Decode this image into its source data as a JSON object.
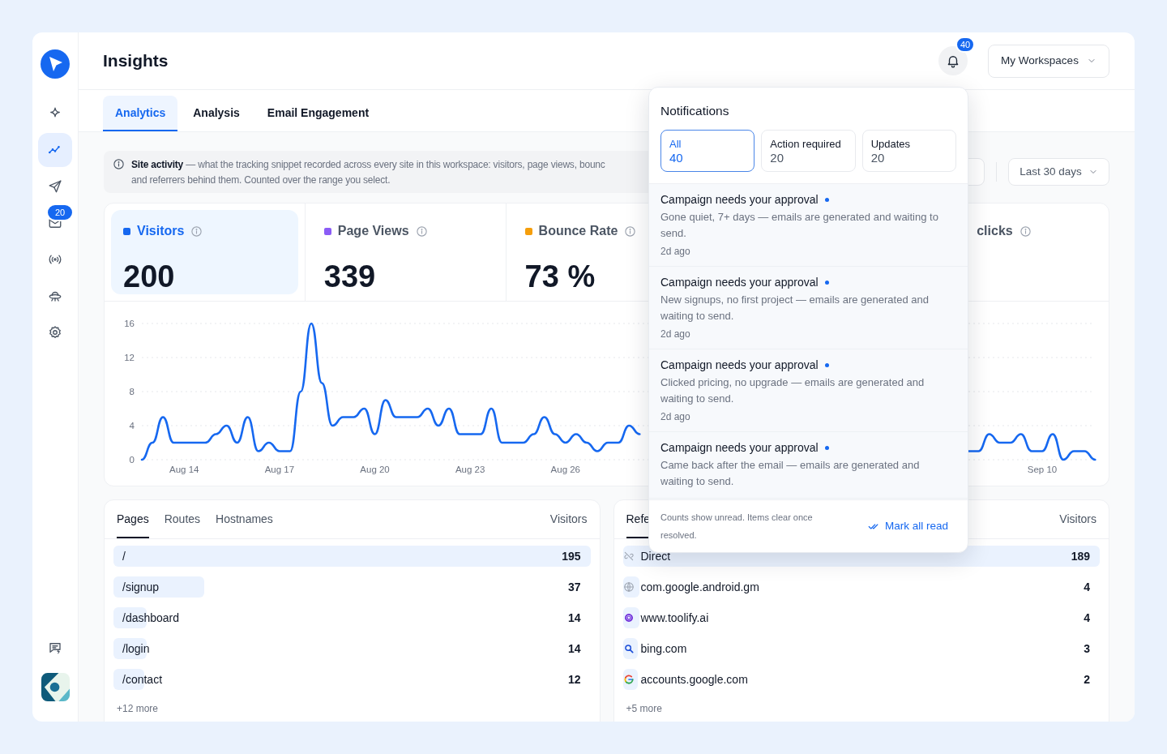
{
  "sidebar": {
    "items": [
      {
        "selected": false
      },
      {
        "selected": true
      },
      {
        "selected": false
      },
      {
        "selected": false,
        "badge": "20"
      },
      {
        "selected": false
      },
      {
        "selected": false
      },
      {
        "selected": false
      }
    ]
  },
  "header": {
    "title": "Insights",
    "notification_count": "40",
    "workspace_button": "My Workspaces"
  },
  "tabs": [
    {
      "label": "Analytics",
      "selected": true
    },
    {
      "label": "Analysis",
      "selected": false
    },
    {
      "label": "Email Engagement",
      "selected": false
    }
  ],
  "info_banner": {
    "lines": [
      "**Site activity** — what the tracking snippet recorded across every site in this workspace: visitors, page views, bounc",
      "and referrers behind them. Counted over the range you select."
    ]
  },
  "date_range": "Last 30 days",
  "metrics": [
    {
      "label": "Visitors",
      "value": "200",
      "color": "#1668f0",
      "selected": true
    },
    {
      "label": "Page Views",
      "value": "339",
      "color": "#8b5cf6",
      "selected": false
    },
    {
      "label": "Bounce Rate",
      "value": "73 %",
      "color": "#f59e0b",
      "selected": false
    },
    {
      "label": "clicks",
      "selected": false
    }
  ],
  "chart_data": {
    "type": "line",
    "categories": [
      null,
      null,
      null,
      null,
      "Aug 14",
      null,
      null,
      null,
      null,
      null,
      null,
      null,
      null,
      "Aug 17",
      null,
      null,
      null,
      null,
      null,
      null,
      null,
      null,
      "Aug 20",
      null,
      null,
      null,
      null,
      null,
      null,
      null,
      null,
      "Aug 23",
      null,
      null,
      null,
      null,
      null,
      null,
      null,
      null,
      "Aug 26",
      null,
      null,
      null,
      null,
      null,
      null,
      null,
      null,
      null,
      null,
      null,
      null,
      null,
      null,
      null,
      null,
      null,
      null,
      null,
      null,
      null,
      null,
      null,
      null,
      null,
      null,
      null,
      null,
      null,
      null,
      null,
      null,
      null,
      null,
      null,
      null,
      null,
      null,
      null,
      null,
      null,
      null,
      null,
      null,
      "Sep 10",
      null,
      null,
      null,
      null,
      null
    ],
    "series": [
      {
        "color": "#1668f0",
        "values": [
          0,
          2,
          5,
          2,
          2,
          2,
          2,
          3,
          4,
          2,
          5,
          1,
          2,
          1,
          1,
          8,
          16,
          9,
          4,
          5,
          5,
          6,
          3,
          7,
          5,
          5,
          5,
          6,
          4,
          6,
          3,
          3,
          3,
          6,
          2,
          2,
          2,
          3,
          5,
          3,
          2,
          3,
          2,
          1,
          2,
          2,
          4,
          3,
          null,
          null,
          null,
          null,
          null,
          null,
          null,
          null,
          null,
          null,
          null,
          null,
          null,
          null,
          null,
          null,
          null,
          null,
          null,
          null,
          null,
          null,
          null,
          null,
          null,
          null,
          null,
          null,
          null,
          null,
          1,
          1,
          3,
          2,
          2,
          3,
          1,
          1,
          3,
          0,
          1,
          1,
          0
        ]
      }
    ],
    "ylim": [
      0,
      16
    ],
    "yticks": [
      0,
      4,
      8,
      12,
      16
    ],
    "grid": true
  },
  "pages": {
    "tabs": [
      {
        "label": "Pages",
        "selected": true
      },
      {
        "label": "Routes",
        "selected": false
      },
      {
        "label": "Hostnames",
        "selected": false
      }
    ],
    "column": "Visitors",
    "rows": [
      {
        "label": "/",
        "value": "195",
        "level": 1
      },
      {
        "label": "/signup",
        "value": "37",
        "level": 0.19
      },
      {
        "label": "/dashboard",
        "value": "14",
        "level": 0.07
      },
      {
        "label": "/login",
        "value": "14",
        "level": 0.07
      },
      {
        "label": "/contact",
        "value": "12",
        "level": 0.065
      }
    ],
    "more": "+12 more"
  },
  "referrers": {
    "tabs": [
      {
        "label": "Refe",
        "selected": true
      }
    ],
    "column": "Visitors",
    "rows": [
      {
        "label": "Direct",
        "value": "189",
        "level": 1
      },
      {
        "label": "com.google.android.gm",
        "value": "4",
        "level": 0.034
      },
      {
        "label": "www.toolify.ai",
        "value": "4",
        "level": 0.034
      },
      {
        "label": "bing.com",
        "value": "3",
        "level": 0.032
      },
      {
        "label": "accounts.google.com",
        "value": "2",
        "level": 0.032
      }
    ],
    "more": "+5 more"
  },
  "notifications": {
    "title": "Notifications",
    "filters": [
      {
        "label": "All",
        "count": "40",
        "selected": true
      },
      {
        "label": "Action required",
        "count": "20",
        "selected": false
      },
      {
        "label": "Updates",
        "count": "20",
        "selected": false
      }
    ],
    "items": [
      {
        "title": "Campaign needs your approval",
        "unread": true,
        "body": "Gone quiet, 7+ days — emails are generated and waiting to send.",
        "time": "2d ago"
      },
      {
        "title": "Campaign needs your approval",
        "unread": true,
        "body": "New signups, no first project — emails are generated and waiting to send.",
        "time": "2d ago"
      },
      {
        "title": "Campaign needs your approval",
        "unread": true,
        "body": "Clicked pricing, no upgrade — emails are generated and waiting to send.",
        "time": "2d ago"
      },
      {
        "title": "Campaign needs your approval",
        "unread": true,
        "body": "Came back after the email — emails are generated and waiting to send."
      }
    ],
    "footer": "Counts show unread. Items clear once resolved.",
    "action": "Mark all read"
  }
}
